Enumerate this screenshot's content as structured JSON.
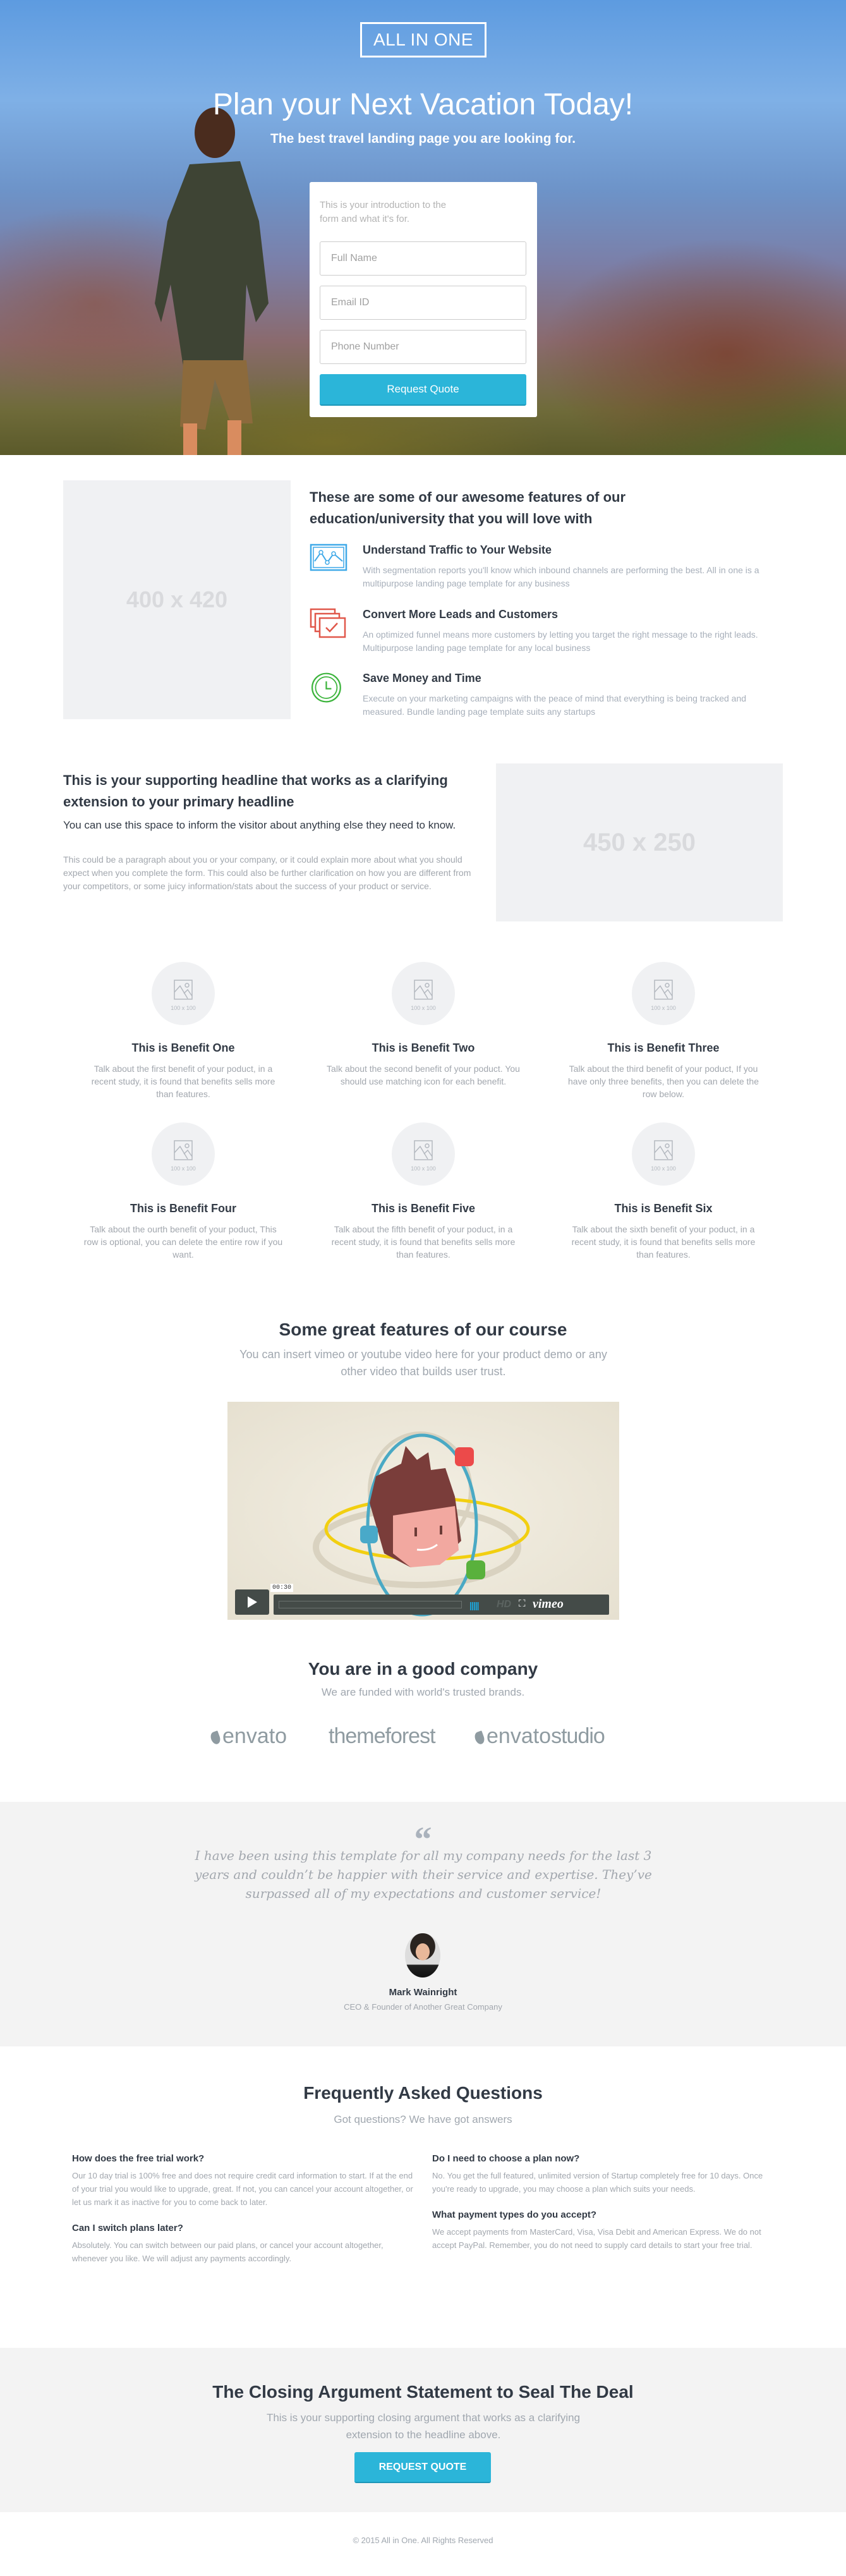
{
  "hero": {
    "logo": "ALL IN ONE",
    "title": "Plan your Next Vacation Today!",
    "subtitle": "The best travel landing page you are looking for.",
    "form": {
      "intro": "This is your introduction to the form and what it's for.",
      "fields": [
        {
          "placeholder": "Full Name",
          "value": ""
        },
        {
          "placeholder": "Email ID",
          "value": ""
        },
        {
          "placeholder": "Phone Number",
          "value": ""
        }
      ],
      "submit_label": "Request Quote"
    }
  },
  "features": {
    "image_placeholder": "400 x 420",
    "title": "These are some of our awesome features of our education/university that you will love with",
    "items": [
      {
        "icon": "traffic-chart-icon",
        "title": "Understand Traffic to Your Website",
        "text": "With segmentation reports you'll know which inbound channels are performing the best. All in one is a multipurpose landing page template for any business",
        "color": "#3fa9e8"
      },
      {
        "icon": "checklist-cards-icon",
        "title": "Convert More Leads and Customers",
        "text": "An optimized funnel means more customers by letting you target the right message to the right leads. Multipurpose landing page template for any local business",
        "color": "#e0574a"
      },
      {
        "icon": "clock-icon",
        "title": "Save Money and Time",
        "text": "Execute on your marketing campaigns with the peace of mind that everything is being tracked and measured. Bundle landing page template suits any startups",
        "color": "#3cb43c"
      }
    ]
  },
  "supporting": {
    "headline": "This is your supporting headline that works as a clarifying extension to your primary headline",
    "subheadline": "You can use this space to inform the visitor about anything else they need to know.",
    "paragraph": "This could be a paragraph about you or your company, or it could explain more about what you should expect when you complete the form. This could also be further clarification on how you are different from your competitors, or some juicy information/stats about the success of your product or service.",
    "image_placeholder": "450 x 250"
  },
  "benefits": {
    "image_placeholder": "100 x 100",
    "items": [
      {
        "title": "This is Benefit One",
        "text": "Talk about the first benefit of your poduct, in a recent study, it is found that benefits sells more than features."
      },
      {
        "title": "This is Benefit Two",
        "text": "Talk about the second benefit of your poduct. You should use matching icon for each benefit."
      },
      {
        "title": "This is Benefit Three",
        "text": "Talk about the third benefit of your poduct, If you have only three benefits, then you can delete the row below."
      },
      {
        "title": "This is Benefit Four",
        "text": "Talk about the ourth benefit of your poduct, This row is optional, you can delete the entire row if you want."
      },
      {
        "title": "This is Benefit Five",
        "text": "Talk about the fifth benefit of your poduct, in a recent study, it is found that benefits sells more than features."
      },
      {
        "title": "This is Benefit Six",
        "text": "Talk about the sixth benefit of your poduct, in a recent study, it is found that benefits sells more than features."
      }
    ]
  },
  "video": {
    "title": "Some great features of our course",
    "subtitle": "You can insert vimeo or youtube video here for your product demo or any other video that builds user trust.",
    "time": "00:30",
    "hd_label": "HD",
    "player_brand": "vimeo",
    "progress": 0
  },
  "brands": {
    "title": "You are in a good company",
    "subtitle": "We are funded with world's trusted brands.",
    "logos": [
      "envato",
      "themeforest",
      "envato",
      "studio"
    ]
  },
  "testimonial": {
    "quote_mark": "“",
    "quote": "I have been using this template for all my company needs for the last 3 years and couldn’t be happier with their service and expertise. They’ve surpassed all of my expectations and customer service!",
    "name": "Mark Wainright",
    "role": "CEO & Founder of Another Great Company"
  },
  "faq": {
    "title": "Frequently Asked Questions",
    "subtitle": "Got questions? We have got answers",
    "items": [
      {
        "q": "How does the free trial work?",
        "a": "Our 10 day trial is 100% free and does not require credit card information to start. If at the end of your trial you would like to upgrade, great. If not, you can cancel your account altogether, or let us mark it as inactive for you to come back to later."
      },
      {
        "q": "Can I switch plans later?",
        "a": "Absolutely. You can switch between our paid plans, or cancel your account altogether, whenever you like. We will adjust any payments accordingly."
      },
      {
        "q": "Do I need to choose a plan now?",
        "a": "No. You get the full featured, unlimited version of Startup completely free for 10 days. Once you're ready to upgrade, you may choose a plan which suits your needs."
      },
      {
        "q": "What payment types do you accept?",
        "a": "We accept payments from MasterCard, Visa, Visa Debit and American Express. We do not accept PayPal. Remember, you do not need to supply card details to start your free trial."
      }
    ]
  },
  "cta": {
    "title": "The Closing Argument Statement to Seal The Deal",
    "text": "This is your supporting closing argument that works as a clarifying extension to the headline above.",
    "button_label": "REQUEST QUOTE"
  },
  "footer": {
    "copyright": "© 2015 All in One. All Rights Reserved"
  },
  "colors": {
    "accent": "#2bb5d9",
    "heading": "#323a45",
    "muted": "#a2a7ae",
    "panel": "#f3f3f3"
  }
}
